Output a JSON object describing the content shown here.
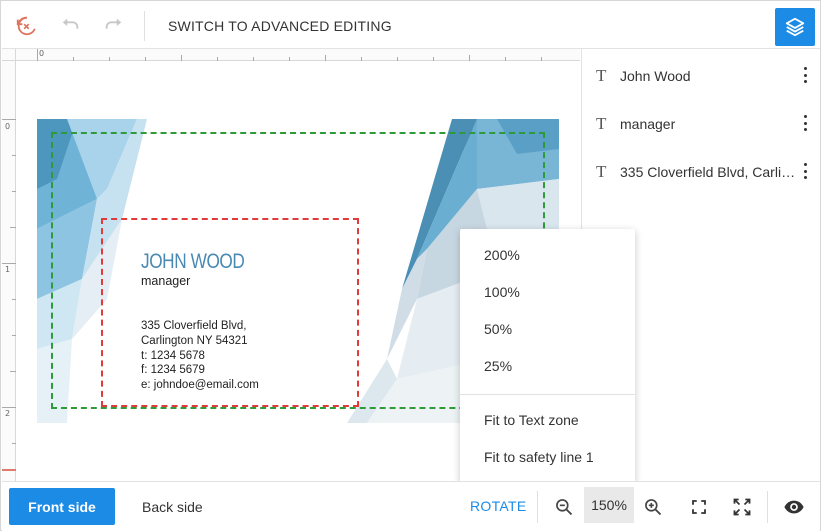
{
  "toolbar": {
    "undo_history_icon": "history-undo-icon",
    "advanced_label": "SWITCH TO ADVANCED EDITING",
    "layers_icon": "layers-icon"
  },
  "ruler": {
    "top_labels": [
      "0"
    ],
    "left_labels": [
      "0",
      "1",
      "2"
    ]
  },
  "card": {
    "name": "JOHN WOOD",
    "title": "manager",
    "address": "335 Cloverfield Blvd,\nCarlington NY 54321\nt: 1234 5678\nf: 1234 5679\ne: johndoe@email.com"
  },
  "layers": [
    {
      "label": "John Wood",
      "icon": "T"
    },
    {
      "label": "manager",
      "icon": "T"
    },
    {
      "label": "335 Cloverfield Blvd, Carlin…",
      "icon": "T"
    }
  ],
  "zoom_menu": {
    "options": [
      "200%",
      "100%",
      "50%",
      "25%"
    ],
    "fit_options": [
      "Fit to Text zone",
      "Fit to safety line 1"
    ]
  },
  "bottom": {
    "front_label": "Front side",
    "back_label": "Back side",
    "rotate_label": "ROTATE",
    "zoom_value": "150%"
  },
  "colors": {
    "accent": "#1c8be6",
    "safety_line": "#2e9a38",
    "text_zone": "#e03a3a",
    "card_name": "#4a89b2"
  }
}
